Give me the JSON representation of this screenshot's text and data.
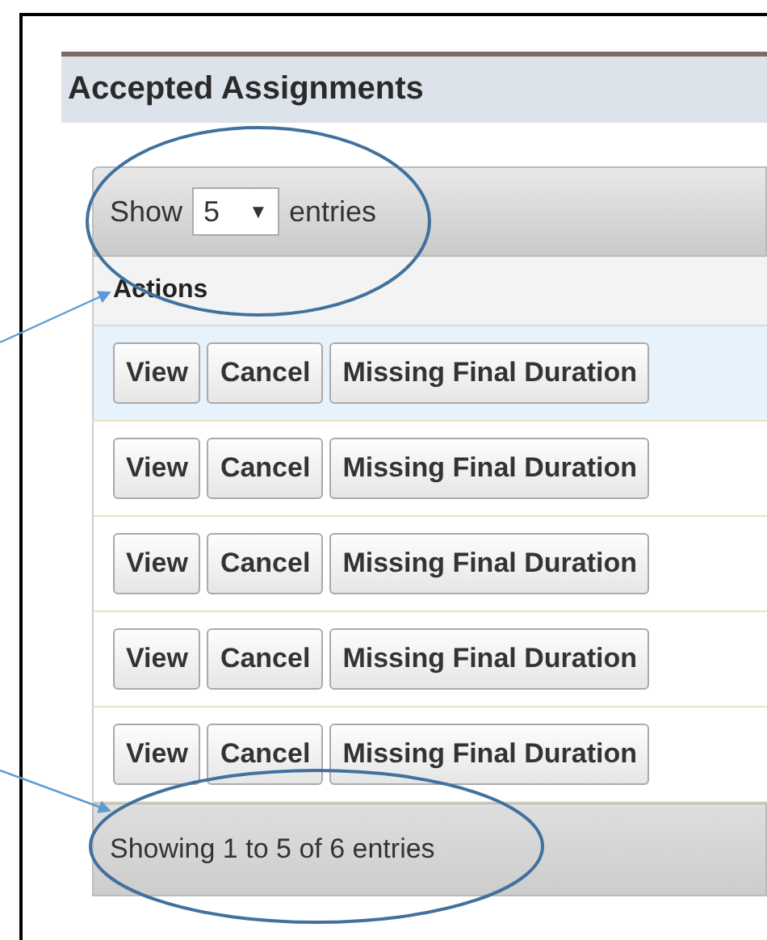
{
  "panel": {
    "title": "Accepted Assignments"
  },
  "length_menu": {
    "label_before": "Show",
    "value": "5",
    "caret": "▼",
    "label_after": "entries"
  },
  "table": {
    "columns": [
      "Actions"
    ],
    "rows": [
      {
        "selected": true,
        "buttons": [
          "View",
          "Cancel",
          "Missing Final Duration"
        ]
      },
      {
        "selected": false,
        "buttons": [
          "View",
          "Cancel",
          "Missing Final Duration"
        ]
      },
      {
        "selected": false,
        "buttons": [
          "View",
          "Cancel",
          "Missing Final Duration"
        ]
      },
      {
        "selected": false,
        "buttons": [
          "View",
          "Cancel",
          "Missing Final Duration"
        ]
      },
      {
        "selected": false,
        "buttons": [
          "View",
          "Cancel",
          "Missing Final Duration"
        ]
      }
    ]
  },
  "info": "Showing 1 to 5 of 6 entries"
}
